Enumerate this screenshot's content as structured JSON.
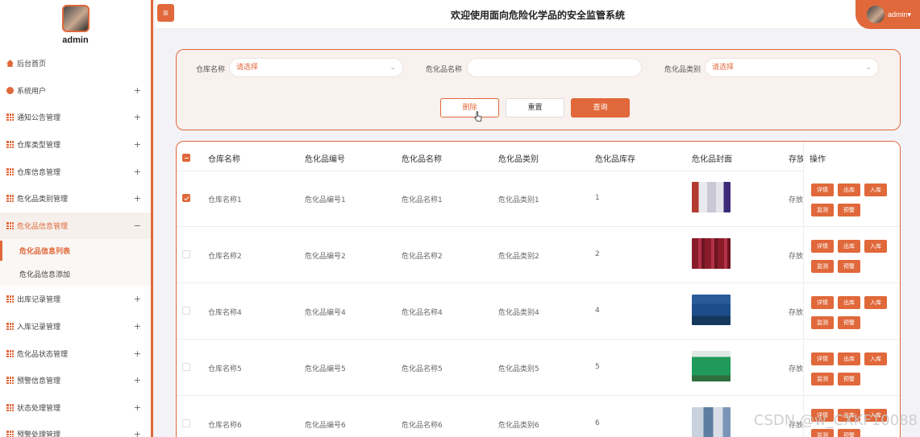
{
  "sidebar": {
    "username": "admin",
    "items": [
      {
        "label": "后台首页",
        "icon": "home-icon"
      },
      {
        "label": "系统用户",
        "icon": "user-icon",
        "expand": "+"
      },
      {
        "label": "通知公告管理",
        "icon": "grid-icon",
        "expand": "+"
      },
      {
        "label": "仓库类型管理",
        "icon": "grid-icon",
        "expand": "+"
      },
      {
        "label": "仓库信息管理",
        "icon": "grid-icon",
        "expand": "+"
      },
      {
        "label": "危化品类别管理",
        "icon": "grid-icon",
        "expand": "+"
      },
      {
        "label": "危化品信息管理",
        "icon": "grid-icon",
        "expand": "−"
      },
      {
        "label": "出库记录管理",
        "icon": "grid-icon",
        "expand": "+"
      },
      {
        "label": "入库记录管理",
        "icon": "grid-icon",
        "expand": "+"
      },
      {
        "label": "危化品状态管理",
        "icon": "grid-icon",
        "expand": "+"
      },
      {
        "label": "预警信息管理",
        "icon": "grid-icon",
        "expand": "+"
      },
      {
        "label": "状态处理管理",
        "icon": "grid-icon",
        "expand": "+"
      },
      {
        "label": "预警处理管理",
        "icon": "grid-icon",
        "expand": "+"
      }
    ],
    "submenu": [
      {
        "label": "危化品信息列表",
        "active": true
      },
      {
        "label": "危化品信息添加",
        "active": false
      }
    ]
  },
  "header": {
    "menu_toggle": "≡",
    "title": "欢迎使用面向危险化学品的安全监管系统",
    "user": "admin",
    "user_caret": "▾"
  },
  "search": {
    "warehouse_label": "仓库名称",
    "warehouse_placeholder": "请选择",
    "name_label": "危化品名称",
    "name_value": "",
    "category_label": "危化品类别",
    "category_placeholder": "请选择",
    "delete_label": "删除",
    "reset_label": "重置",
    "query_label": "查询"
  },
  "table": {
    "headers": [
      "仓库名称",
      "危化品编号",
      "危化品名称",
      "危化品类别",
      "危化品库存",
      "危化品封面",
      "存放",
      "操作"
    ],
    "rows": [
      {
        "warehouse": "仓库名称1",
        "code": "危化品编号1",
        "name": "危化品名称1",
        "category": "危化品类别1",
        "stock": "1",
        "storage": "存放",
        "checked": true
      },
      {
        "warehouse": "仓库名称2",
        "code": "危化品编号2",
        "name": "危化品名称2",
        "category": "危化品类别2",
        "stock": "2",
        "storage": "存放",
        "checked": false
      },
      {
        "warehouse": "仓库名称4",
        "code": "危化品编号4",
        "name": "危化品名称4",
        "category": "危化品类别4",
        "stock": "4",
        "storage": "存放",
        "checked": false
      },
      {
        "warehouse": "仓库名称5",
        "code": "危化品编号5",
        "name": "危化品名称5",
        "category": "危化品类别5",
        "stock": "5",
        "storage": "存放",
        "checked": false
      },
      {
        "warehouse": "仓库名称6",
        "code": "危化品编号6",
        "name": "危化品名称6",
        "category": "危化品类别6",
        "stock": "6",
        "storage": "存放",
        "checked": false
      }
    ],
    "actions": [
      "详情",
      "出库",
      "入库",
      "监测",
      "预警"
    ]
  },
  "colors": {
    "accent": "#e0683a"
  },
  "watermark": "CSDN @w_CXKF10088"
}
